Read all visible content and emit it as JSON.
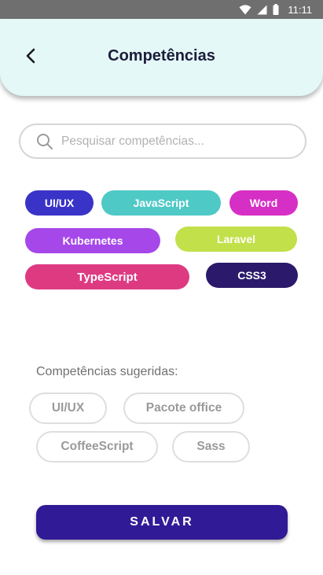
{
  "status_bar": {
    "time": "11:11"
  },
  "header": {
    "title": "Competências"
  },
  "search": {
    "placeholder": "Pesquisar competências..."
  },
  "selected_skills": [
    {
      "label": "UI/UX",
      "color": "#3a33c8"
    },
    {
      "label": "JavaScript",
      "color": "#4fc9c6"
    },
    {
      "label": "Word",
      "color": "#d62fc5"
    },
    {
      "label": "Kubernetes",
      "color": "#a647ea"
    },
    {
      "label": "Laravel",
      "color": "#c2e04a"
    },
    {
      "label": "TypeScript",
      "color": "#de3a82"
    },
    {
      "label": "CSS3",
      "color": "#2b1a6b"
    }
  ],
  "suggested": {
    "title": "Competências sugeridas:",
    "items": [
      {
        "label": "UI/UX"
      },
      {
        "label": "Pacote office"
      },
      {
        "label": "CoffeeScript"
      },
      {
        "label": "Sass"
      }
    ]
  },
  "actions": {
    "save_label": "SALVAR"
  },
  "colors": {
    "accent": "#311a96",
    "header_bg": "#e3f8f7"
  }
}
